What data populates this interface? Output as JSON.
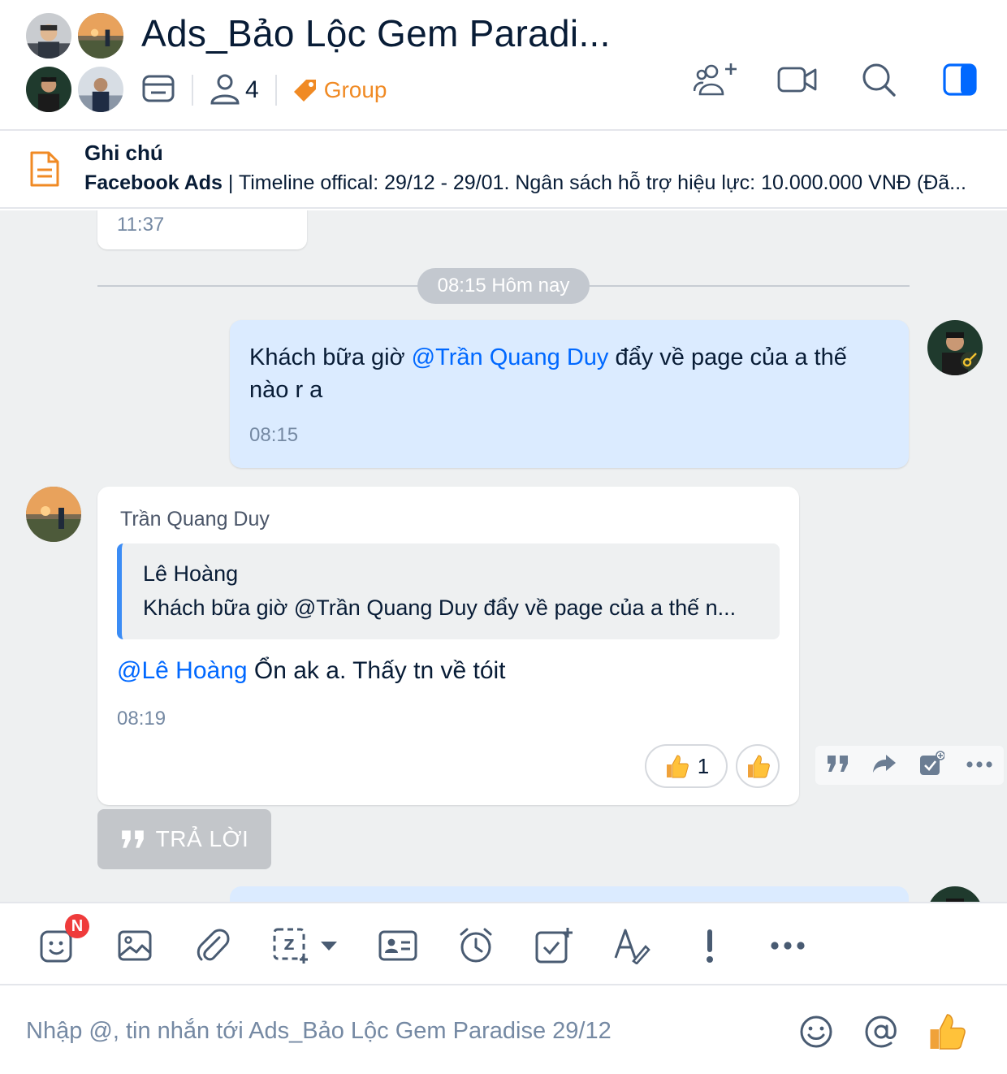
{
  "header": {
    "title": "Ads_Bảo Lộc Gem Paradi...",
    "member_count": "4",
    "tag_label": "Group",
    "accent_color": "#0068ff",
    "tag_color": "#f08a24"
  },
  "pinned_note": {
    "title": "Ghi chú",
    "label": "Facebook Ads",
    "text": " | Timeline offical: 29/12 - 29/01. Ngân sách hỗ trợ hiệu lực: 10.000.000 VNĐ (Đã..."
  },
  "chat": {
    "previous_time": "11:37",
    "date_divider": "08:15 Hôm nay",
    "messages": [
      {
        "text_before": "Khách bữa giờ ",
        "mention": "@Trần Quang Duy",
        "text_after": " đẩy về page của a thế nào r a",
        "time": "08:15"
      },
      {
        "sender": "Trần Quang Duy",
        "quote_author": "Lê Hoàng",
        "quote_text": "Khách bữa giờ @Trần Quang Duy đẩy về page của a thế n...",
        "mention": "@Lê Hoàng",
        "text_after": " Ổn ak a. Thấy tn về tóit",
        "time": "08:19",
        "reaction_count": "1"
      }
    ],
    "reply_button_label": "TRẢ LỜI"
  },
  "toolbar": {
    "sticker_badge": "N"
  },
  "composer": {
    "placeholder": "Nhập @, tin nhắn tới Ads_Bảo Lộc Gem Paradise 29/12"
  }
}
